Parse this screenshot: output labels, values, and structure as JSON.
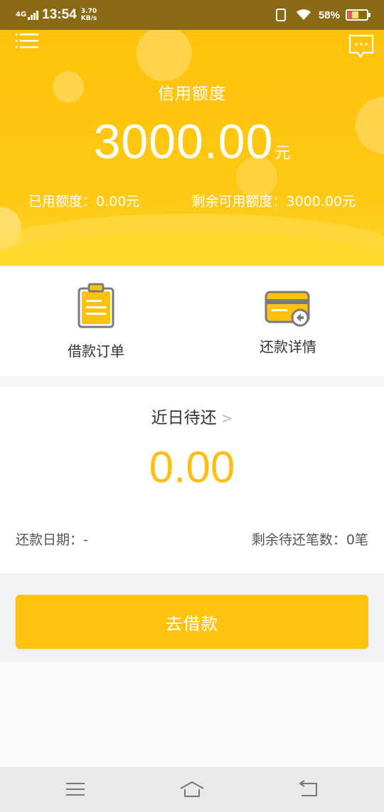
{
  "status_bar": {
    "network": "4G",
    "time": "13:54",
    "speed_value": "3.70",
    "speed_unit": "KB/s",
    "battery_percent": "58%"
  },
  "header": {
    "credit_label": "信用额度",
    "credit_amount": "3000.00",
    "credit_unit": "元",
    "used_credit": "已用额度：0.00元",
    "remaining_credit": "剩余可用额度：3000.00元"
  },
  "shortcuts": [
    {
      "label": "借款订单",
      "icon": "clipboard-order-icon"
    },
    {
      "label": "还款详情",
      "icon": "card-repayment-icon"
    }
  ],
  "repayment": {
    "title": "近日待还",
    "amount": "0.00",
    "date_text": "还款日期：-",
    "remaining_count_text": "剩余待还笔数：0笔"
  },
  "action": {
    "loan_button_label": "去借款"
  },
  "colors": {
    "brand_yellow": "#ffc20c",
    "amount_yellow": "#ffbe14",
    "status_bar": "#8b6a16"
  },
  "nav": {
    "icons": [
      "menu-icon",
      "home-icon",
      "back-icon"
    ]
  }
}
